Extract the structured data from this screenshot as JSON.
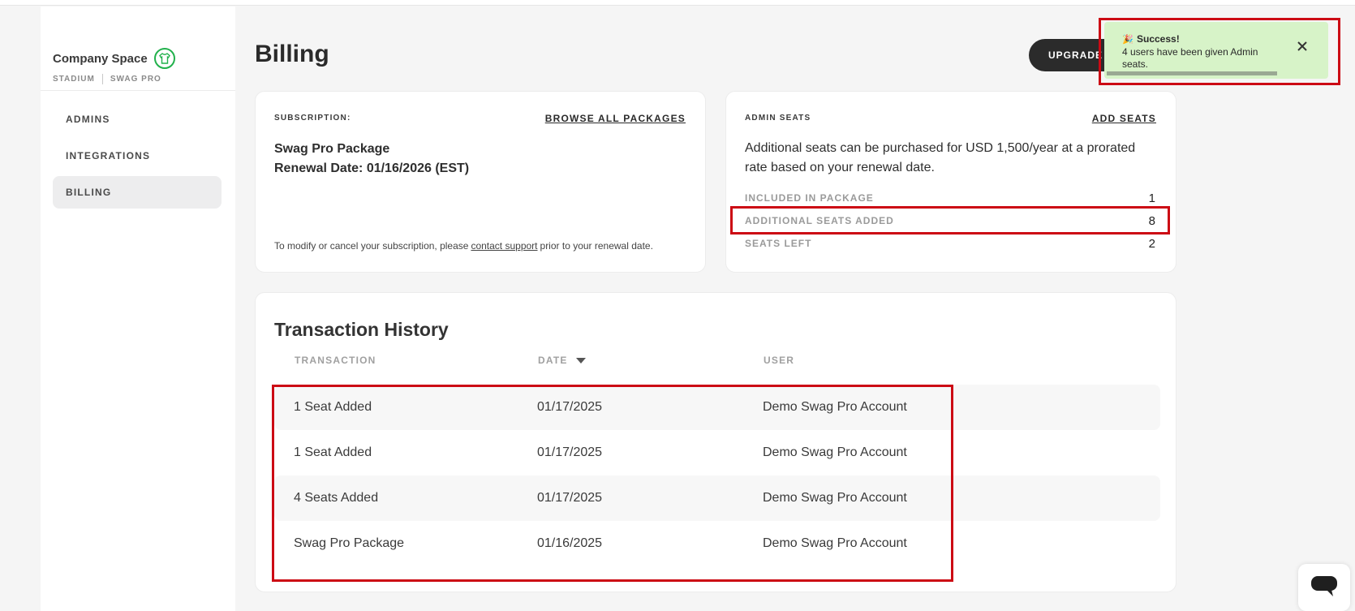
{
  "sidebar": {
    "company_name": "Company Space",
    "meta_left": "STADIUM",
    "meta_right": "SWAG PRO",
    "items": [
      {
        "label": "ADMINS"
      },
      {
        "label": "INTEGRATIONS"
      },
      {
        "label": "BILLING",
        "active": true
      }
    ]
  },
  "header": {
    "title": "Billing",
    "upgrade_label": "UPGRADE"
  },
  "subscription": {
    "label": "SUBSCRIPTION:",
    "link": "BROWSE ALL PACKAGES",
    "package": "Swag Pro Package",
    "renewal": "Renewal Date: 01/16/2026 (EST)",
    "foot_before": "To modify or cancel your subscription, please",
    "foot_link": "contact support",
    "foot_after": "prior to your renewal date."
  },
  "admin_seats": {
    "label": "ADMIN SEATS",
    "link": "ADD SEATS",
    "description": "Additional seats can be purchased for USD 1,500/year at a prorated rate based on your renewal date.",
    "rows": [
      {
        "label": "INCLUDED IN PACKAGE",
        "value": "1"
      },
      {
        "label": "ADDITIONAL SEATS ADDED",
        "value": "8"
      },
      {
        "label": "SEATS LEFT",
        "value": "2"
      }
    ]
  },
  "transactions": {
    "title": "Transaction History",
    "columns": {
      "transaction": "TRANSACTION",
      "date": "DATE",
      "user": "USER"
    },
    "rows": [
      {
        "transaction": "1 Seat Added",
        "date": "01/17/2025",
        "user": "Demo Swag Pro Account"
      },
      {
        "transaction": "1 Seat Added",
        "date": "01/17/2025",
        "user": "Demo Swag Pro Account"
      },
      {
        "transaction": "4 Seats Added",
        "date": "01/17/2025",
        "user": "Demo Swag Pro Account"
      },
      {
        "transaction": "Swag Pro Package",
        "date": "01/16/2025",
        "user": "Demo Swag Pro Account"
      }
    ]
  },
  "toast": {
    "icon": "🎉",
    "title": "Success!",
    "message": "4 users have been given Admin seats."
  },
  "colors": {
    "highlight": "#cc0a14",
    "toast_bg": "#d7f3c8",
    "primary_dark": "#2b2b2b",
    "logo_green": "#22b14c"
  },
  "icons": {
    "logo": "shirt-logo-icon",
    "close": "close-icon",
    "sort": "caret-down-icon",
    "chat": "chat-icon",
    "toast": "party-popper-icon"
  }
}
